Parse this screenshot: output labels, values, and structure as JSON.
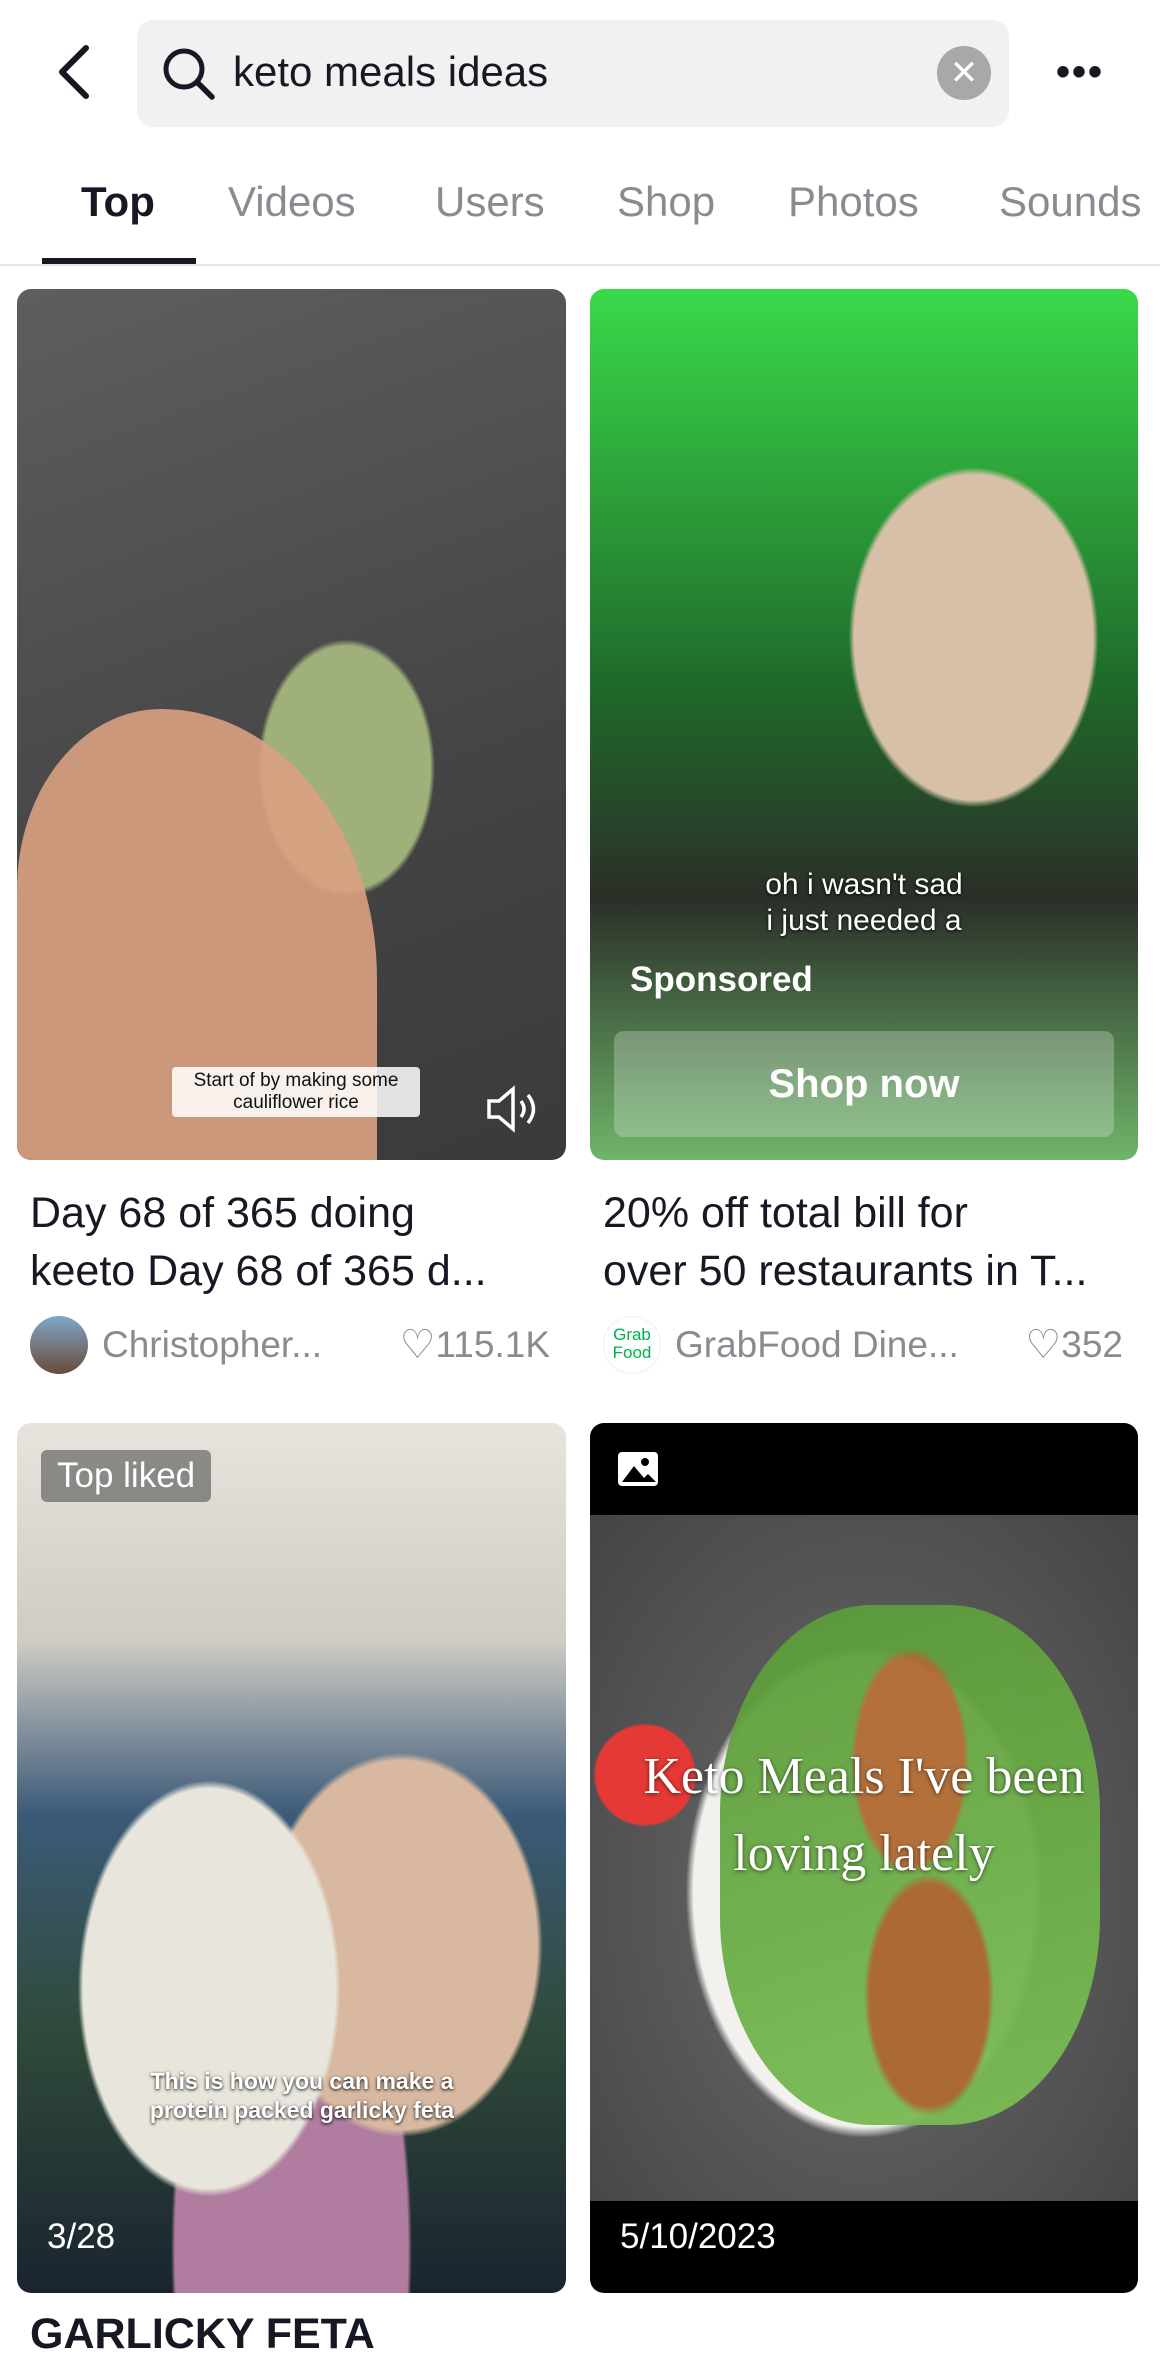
{
  "search": {
    "query": "keto meals ideas"
  },
  "tabs": [
    {
      "label": "Top"
    },
    {
      "label": "Videos"
    },
    {
      "label": "Users"
    },
    {
      "label": "Shop"
    },
    {
      "label": "Photos"
    },
    {
      "label": "Sounds"
    }
  ],
  "results": [
    {
      "caption_overlay": "Start of by making some cauliflower rice",
      "title_line1": "Day 68 of 365 doing",
      "title_line2": "keeto Day 68 of 365 d...",
      "author": "Christopher...",
      "likes": "115.1K"
    },
    {
      "overlay_line1": "oh i wasn't sad",
      "overlay_line2": "i just needed a",
      "sponsored": "Sponsored",
      "cta": "Shop now",
      "title_line1": "20% off total bill for",
      "title_line2": "over 50 restaurants in T...",
      "author": "GrabFood Dine...",
      "author_logo_text": "Grab Food",
      "likes": "352",
      "brand_color": "#00b14f"
    },
    {
      "badge": "Top liked",
      "caption_overlay": "This is how you can make a protein packed garlicky feta",
      "date": "3/28",
      "title_line1": "GARLICKY FETA"
    },
    {
      "overlay_text": "Keto Meals I've been loving lately",
      "date": "5/10/2023"
    }
  ]
}
